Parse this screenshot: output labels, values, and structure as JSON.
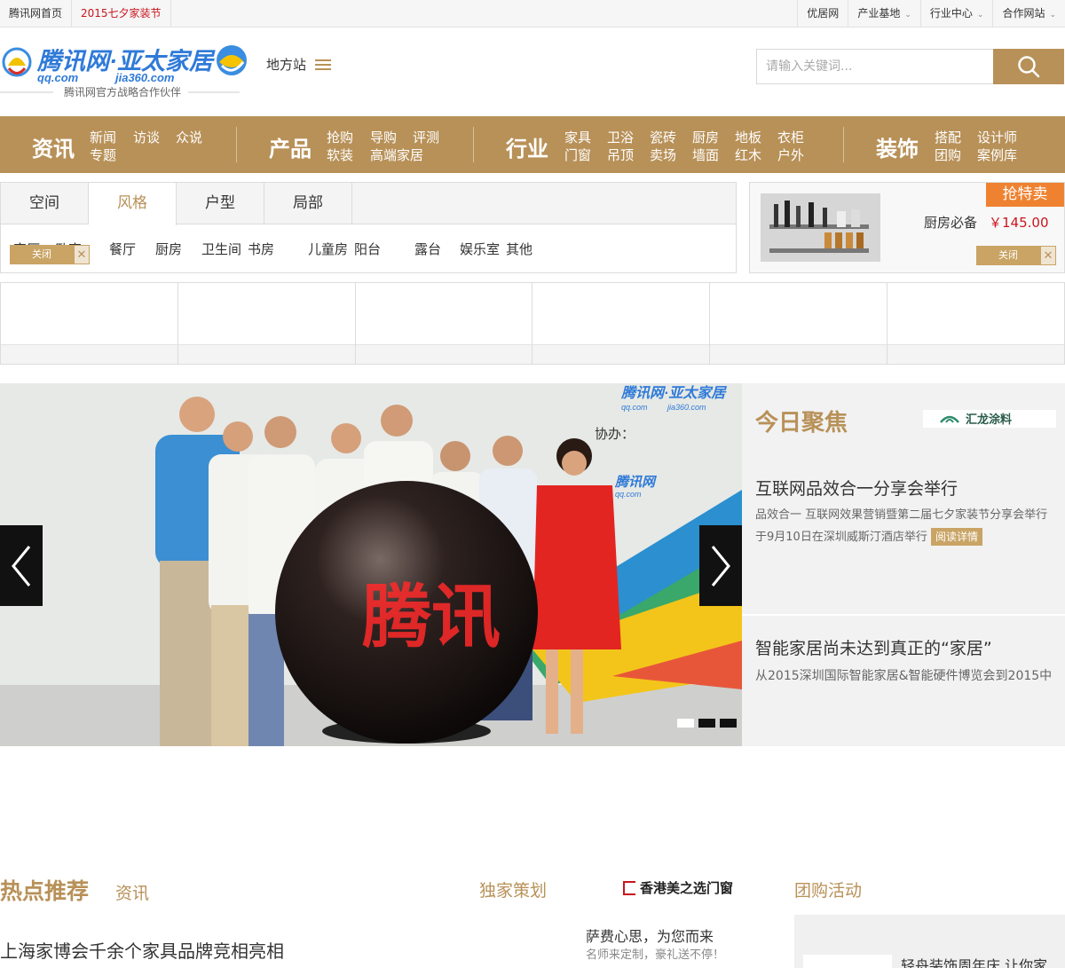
{
  "topbar": {
    "left": [
      "腾讯网首页",
      "2015七夕家装节"
    ],
    "right": [
      "优居网",
      "产业基地",
      "行业中心",
      "合作网站"
    ]
  },
  "header": {
    "logo_text": "腾讯网·亚太家居",
    "logo_domain_left": "qq.com",
    "logo_domain_right": "jia360.com",
    "logo_tagline": "腾讯网官方战略合作伙伴",
    "local_station": "地方站",
    "search_placeholder": "请输入关键词..."
  },
  "nav": [
    {
      "category": "资讯",
      "links": [
        "新闻",
        "访谈",
        "众说",
        "专题"
      ]
    },
    {
      "category": "产品",
      "links": [
        "抢购",
        "导购",
        "评测",
        "软装",
        "高端家居"
      ]
    },
    {
      "category": "行业",
      "links": [
        "家具",
        "卫浴",
        "瓷砖",
        "厨房",
        "地板",
        "衣柜",
        "门窗",
        "吊顶",
        "卖场",
        "墙面",
        "红木",
        "户外"
      ]
    },
    {
      "category": "装饰",
      "links": [
        "搭配",
        "设计师",
        "团购",
        "案例库"
      ]
    }
  ],
  "tabs": {
    "items": [
      "空间",
      "风格",
      "户型",
      "局部"
    ],
    "active": "风格",
    "tags": [
      "客厅",
      "卧室",
      "餐厅",
      "厨房",
      "卫生间",
      "书房",
      "儿童房",
      "阳台",
      "露台",
      "娱乐室",
      "其他"
    ],
    "close_label": "关闭"
  },
  "promo": {
    "badge": "抢特卖",
    "name": "厨房必备",
    "price": "￥145.00",
    "close_label": "关闭"
  },
  "banner": {
    "sign_text": "腾讯网·亚太家居",
    "sign_domain": "qq.com",
    "sign_domain2": "jia360.com",
    "sponsor_label": "协办：",
    "sponsor_logo": "腾讯网",
    "sponsor_domain": "qq.com",
    "ball_text": "腾讯"
  },
  "focus": {
    "title": "今日聚焦",
    "sponsor": "汇龙涂料",
    "item1_title": "互联网品效合一分享会举行",
    "item1_desc": "品效合一 互联网效果营销暨第二届七夕家装节分享会举行于9月10日在深圳威斯汀酒店举行",
    "read_more": "阅读详情",
    "item2_title": "智能家居尚未达到真正的“家居”",
    "item2_desc": "从2015深圳国际智能家居&智能硬件博览会到2015中"
  },
  "bottom": {
    "hot_title": "热点推荐",
    "hot_sub": "资讯",
    "exclusive": "独家策划",
    "hk_brand": "香港美之选门窗",
    "group_buy": "团购活动",
    "news1": "上海家博会千余个家具品牌竞相亮相",
    "side1": "萨费心思，为您而来",
    "side2": "名师来定制，豪礼送不停！",
    "group1": "轻舟装饰周年庆 让你家"
  },
  "colors": {
    "accent": "#b89158",
    "red": "#c8161d",
    "orange": "#ef8230"
  }
}
